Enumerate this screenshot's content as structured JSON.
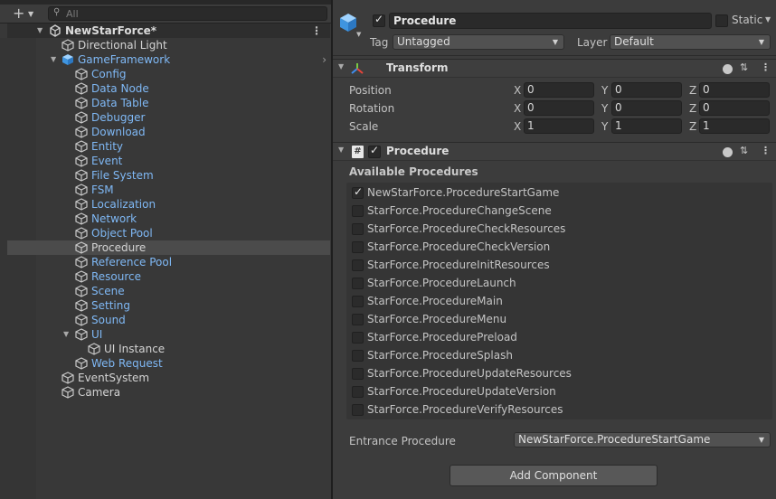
{
  "hierarchy": {
    "search_placeholder": "All",
    "scene_name": "NewStarForce*",
    "items": [
      {
        "label": "Directional Light"
      },
      {
        "label": "GameFramework"
      },
      {
        "label": "Config"
      },
      {
        "label": "Data Node"
      },
      {
        "label": "Data Table"
      },
      {
        "label": "Debugger"
      },
      {
        "label": "Download"
      },
      {
        "label": "Entity"
      },
      {
        "label": "Event"
      },
      {
        "label": "File System"
      },
      {
        "label": "FSM"
      },
      {
        "label": "Localization"
      },
      {
        "label": "Network"
      },
      {
        "label": "Object Pool"
      },
      {
        "label": "Procedure"
      },
      {
        "label": "Reference Pool"
      },
      {
        "label": "Resource"
      },
      {
        "label": "Scene"
      },
      {
        "label": "Setting"
      },
      {
        "label": "Sound"
      },
      {
        "label": "UI"
      },
      {
        "label": "UI Instance"
      },
      {
        "label": "Web Request"
      },
      {
        "label": "EventSystem"
      },
      {
        "label": "Camera"
      }
    ]
  },
  "inspector": {
    "object_name": "Procedure",
    "static_label": "Static",
    "tag_label": "Tag",
    "tag_value": "Untagged",
    "layer_label": "Layer",
    "layer_value": "Default",
    "transform": {
      "title": "Transform",
      "position_label": "Position",
      "rotation_label": "Rotation",
      "scale_label": "Scale",
      "axis_x": "X",
      "axis_y": "Y",
      "axis_z": "Z",
      "position": [
        "0",
        "0",
        "0"
      ],
      "rotation": [
        "0",
        "0",
        "0"
      ],
      "scale": [
        "1",
        "1",
        "1"
      ]
    },
    "procedure_component": {
      "title": "Procedure",
      "script_icon_glyph": "#",
      "available_label": "Available Procedures",
      "procedures": [
        {
          "label": "NewStarForce.ProcedureStartGame",
          "checked": true
        },
        {
          "label": "StarForce.ProcedureChangeScene",
          "checked": false
        },
        {
          "label": "StarForce.ProcedureCheckResources",
          "checked": false
        },
        {
          "label": "StarForce.ProcedureCheckVersion",
          "checked": false
        },
        {
          "label": "StarForce.ProcedureInitResources",
          "checked": false
        },
        {
          "label": "StarForce.ProcedureLaunch",
          "checked": false
        },
        {
          "label": "StarForce.ProcedureMain",
          "checked": false
        },
        {
          "label": "StarForce.ProcedureMenu",
          "checked": false
        },
        {
          "label": "StarForce.ProcedurePreload",
          "checked": false
        },
        {
          "label": "StarForce.ProcedureSplash",
          "checked": false
        },
        {
          "label": "StarForce.ProcedureUpdateResources",
          "checked": false
        },
        {
          "label": "StarForce.ProcedureUpdateVersion",
          "checked": false
        },
        {
          "label": "StarForce.ProcedureVerifyResources",
          "checked": false
        }
      ],
      "entrance_label": "Entrance Procedure",
      "entrance_value": "NewStarForce.ProcedureStartGame"
    },
    "add_component_label": "Add Component"
  },
  "colors": {
    "prefab_blue": "#7fb8f5",
    "panel_bg": "#383838",
    "inspector_bg": "#3c3c3c",
    "selected_row": "#4b4b4b",
    "field_bg": "#2a2a2a"
  }
}
